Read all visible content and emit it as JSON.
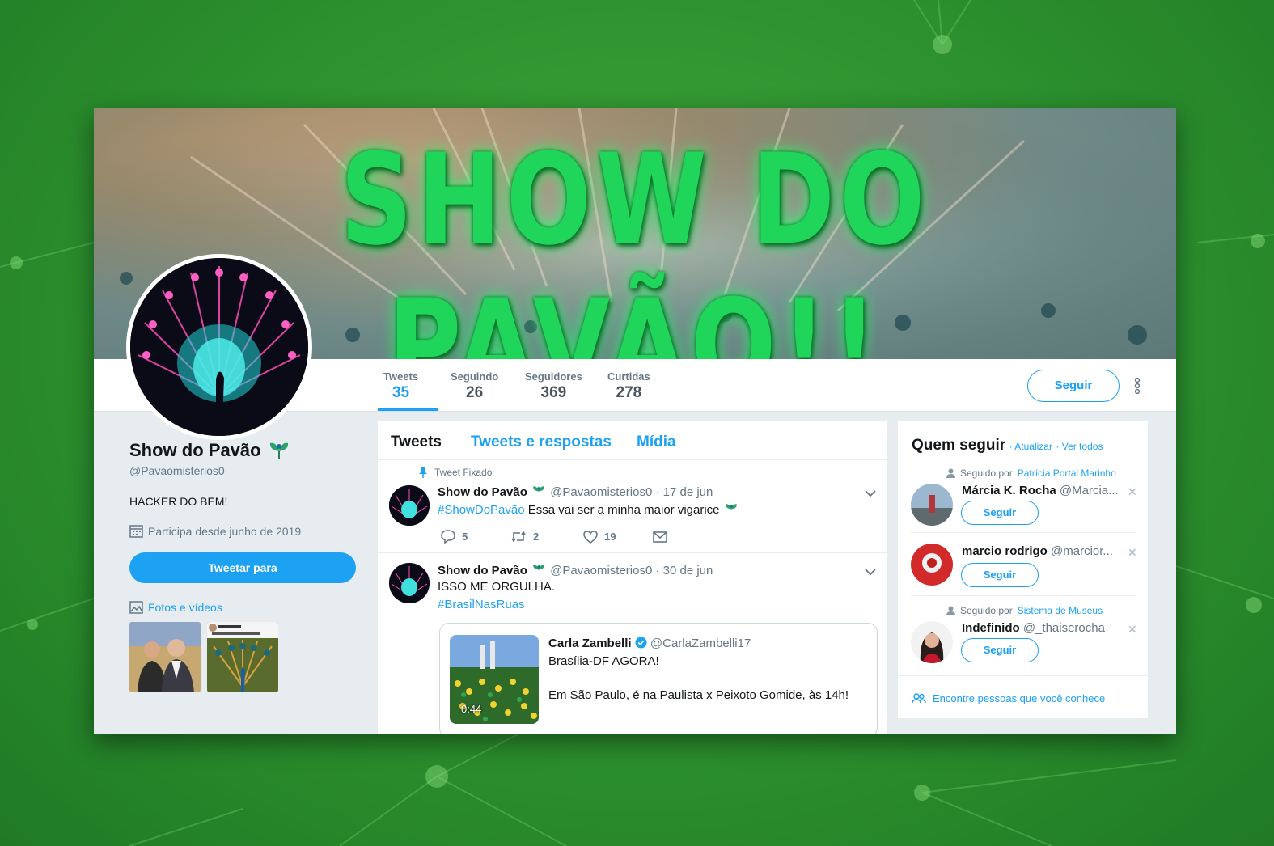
{
  "banner": {
    "title": "SHOW DO PAVÃO!!"
  },
  "profile": {
    "name": "Show do Pavão",
    "handle": "@Pavaomisterios0",
    "bio": "HACKER DO BEM!",
    "joined": "Participa desde junho de 2019",
    "tweet_to_label": "Tweetar para",
    "photos_label": "Fotos e vídeos",
    "emoji_icon": "peacock-icon"
  },
  "stats": [
    {
      "label": "Tweets",
      "value": "35"
    },
    {
      "label": "Seguindo",
      "value": "26"
    },
    {
      "label": "Seguidores",
      "value": "369"
    },
    {
      "label": "Curtidas",
      "value": "278"
    }
  ],
  "follow_button": "Seguir",
  "timeline": {
    "tabs": [
      "Tweets",
      "Tweets e respostas",
      "Mídia"
    ],
    "tweets": [
      {
        "pinned_label": "Tweet Fixado",
        "name": "Show do Pavão",
        "handle": "@Pavaomisterios0",
        "date": "· 17 de jun",
        "hashtag": "#ShowDoPavão",
        "text": "Essa vai ser a minha maior vigarice",
        "replies": "5",
        "retweets": "2",
        "likes": "19"
      },
      {
        "name": "Show do Pavão",
        "handle": "@Pavaomisterios0",
        "date": "· 30 de jun",
        "text": "ISSO ME ORGULHA.",
        "hashtag": "#BrasilNasRuas",
        "quote": {
          "name": "Carla Zambelli",
          "handle": "@CarlaZambelli17",
          "line1": "Brasília-DF AGORA!",
          "line2": "Em São Paulo, é na Paulista x Peixoto Gomide, às 14h!",
          "duration": "0:44"
        }
      }
    ]
  },
  "who_to_follow": {
    "title": "Quem seguir",
    "refresh": "· Atualizar",
    "view_all": "· Ver todos",
    "suggestions": [
      {
        "context": "Seguido por",
        "context_link": "Patrícia Portal Marinho",
        "name": "Márcia K. Rocha",
        "handle": "@Marcia...",
        "button": "Seguir"
      },
      {
        "context": "",
        "context_link": "",
        "name": "marcio rodrigo",
        "handle": "@marcior...",
        "button": "Seguir"
      },
      {
        "context": "Seguido por",
        "context_link": "Sistema de Museus",
        "name": "Indefinido",
        "handle": "@_thaiserocha",
        "button": "Seguir"
      }
    ],
    "find_people": "Encontre pessoas que você conhece"
  },
  "colors": {
    "accent": "#1da1f2",
    "banner_text": "#1fd65a",
    "background": "#2f9530"
  }
}
